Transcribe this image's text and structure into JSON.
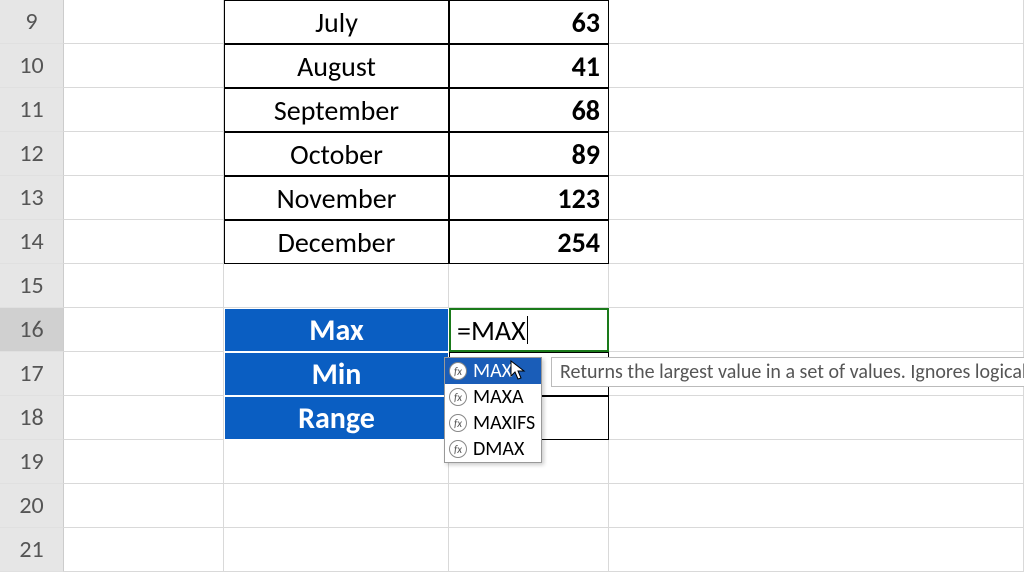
{
  "rows": [
    {
      "num": "9",
      "month": "July",
      "value": "63"
    },
    {
      "num": "10",
      "month": "August",
      "value": "41"
    },
    {
      "num": "11",
      "month": "September",
      "value": "68"
    },
    {
      "num": "12",
      "month": "October",
      "value": "89"
    },
    {
      "num": "13",
      "month": "November",
      "value": "123"
    },
    {
      "num": "14",
      "month": "December",
      "value": "254"
    }
  ],
  "blank_rows": {
    "r15": "15",
    "r19": "19",
    "r20": "20",
    "r21": "21"
  },
  "labels": {
    "max": "Max",
    "min": "Min",
    "range": "Range"
  },
  "row_nums": {
    "r16": "16",
    "r17": "17",
    "r18": "18"
  },
  "formula": "=MAX",
  "autocomplete": {
    "items": [
      "MAX",
      "MAXA",
      "MAXIFS",
      "DMAX"
    ],
    "fx": "fx"
  },
  "tooltip": "Returns the largest value in a set of values. Ignores logical va"
}
